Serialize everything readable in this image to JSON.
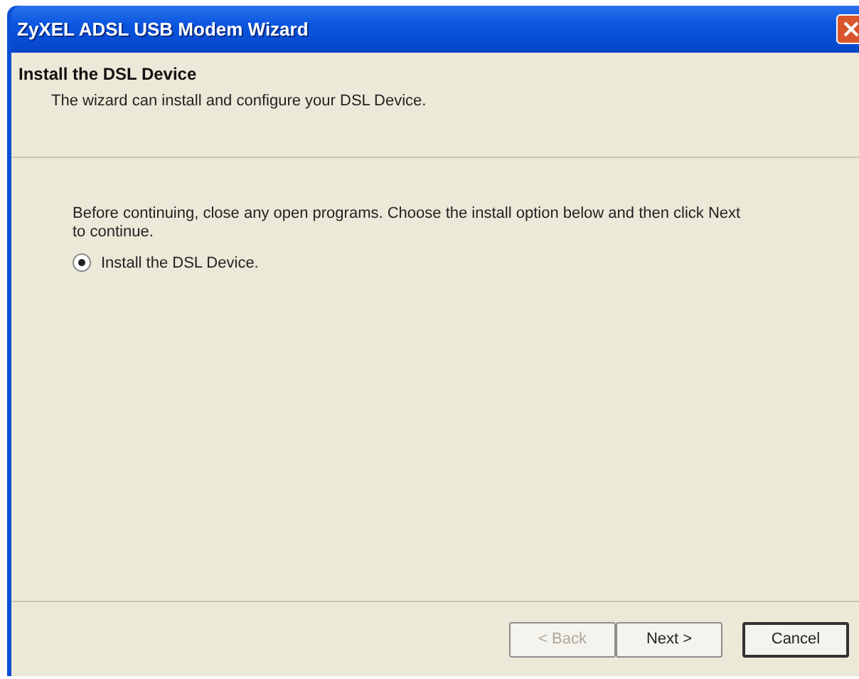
{
  "window": {
    "title": "ZyXEL ADSL USB Modem Wizard"
  },
  "header": {
    "title": "Install the DSL Device",
    "subtitle": "The wizard can install and configure your DSL Device."
  },
  "body": {
    "text": "Before continuing, close any open programs.  Choose the install option below and then click Next to continue.",
    "options": [
      {
        "label": "Install the DSL Device.",
        "selected": true
      }
    ]
  },
  "buttons": [
    {
      "label": "< Back",
      "disabled": true,
      "default": false
    },
    {
      "label": "Next >",
      "disabled": false,
      "default": false
    },
    {
      "label": "Cancel",
      "disabled": false,
      "default": true
    }
  ]
}
